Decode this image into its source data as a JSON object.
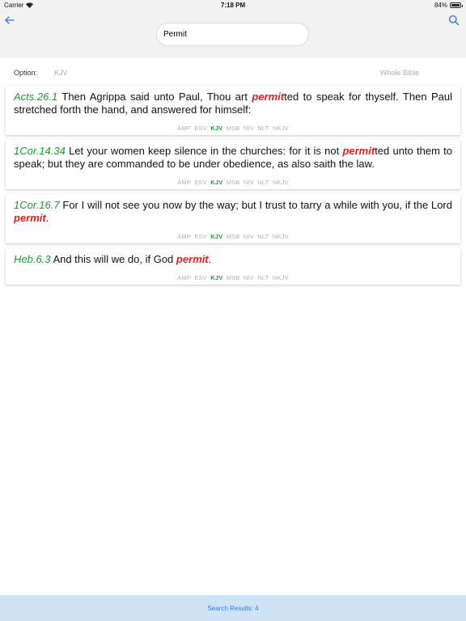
{
  "status": {
    "carrier": "Carrier",
    "time": "7:18 PM",
    "battery": "84%",
    "battery_level": 0.84
  },
  "nav": {
    "back_icon": "back-arrow-icon",
    "search_icon": "search-icon",
    "search_value": "Permit"
  },
  "options": {
    "label": "Option:",
    "version": "KJV",
    "scope": "Whole Bible"
  },
  "colors": {
    "reference": "#1a9a2a",
    "highlight": "#e0201c",
    "accent": "#2b7de0"
  },
  "results": [
    {
      "ref": "Acts.26.1",
      "pre": " Then Agrippa said unto Paul, Thou art ",
      "match": "permit",
      "post": "ted to speak for thyself. Then Paul stretched forth the hand, and answered for himself:",
      "versions": [
        "AMP",
        "ESV",
        "KJV",
        "MSB",
        "NIV",
        "NLT",
        "NKJV"
      ],
      "active_version": "KJV"
    },
    {
      "ref": "1Cor.14.34",
      "pre": " Let your women keep silence in the churches: for it is not ",
      "match": "permit",
      "post": "ted unto them to speak; but they are commanded to be under obedience, as also saith the law.",
      "versions": [
        "AMP",
        "ESV",
        "KJV",
        "MSB",
        "NIV",
        "NLT",
        "NKJV"
      ],
      "active_version": "KJV"
    },
    {
      "ref": "1Cor.16.7",
      "pre": " For I will not see you now by the way; but I trust to tarry a while with you, if the Lord ",
      "match": "permit",
      "post": ".",
      "versions": [
        "AMP",
        "ESV",
        "KJV",
        "MSB",
        "NIV",
        "NLT",
        "NKJV"
      ],
      "active_version": "KJV"
    },
    {
      "ref": "Heb.6.3",
      "pre": " And this will we do, if God ",
      "match": "permit",
      "post": ".",
      "versions": [
        "AMP",
        "ESV",
        "KJV",
        "MSB",
        "NIV",
        "NLT",
        "NKJV"
      ],
      "active_version": "KJV"
    }
  ],
  "footer": {
    "results_text": "Search Results: 4"
  }
}
